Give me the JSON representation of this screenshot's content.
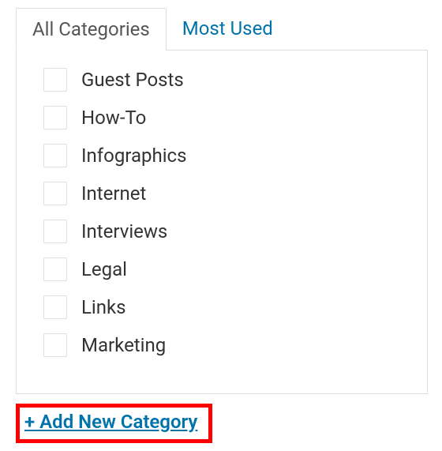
{
  "tabs": {
    "all": "All Categories",
    "most_used": "Most Used"
  },
  "categories": [
    {
      "label": "Guest Posts"
    },
    {
      "label": "How-To"
    },
    {
      "label": "Infographics"
    },
    {
      "label": "Internet"
    },
    {
      "label": "Interviews"
    },
    {
      "label": "Legal"
    },
    {
      "label": "Links"
    },
    {
      "label": "Marketing"
    }
  ],
  "add_new_label": "+ Add New Category"
}
